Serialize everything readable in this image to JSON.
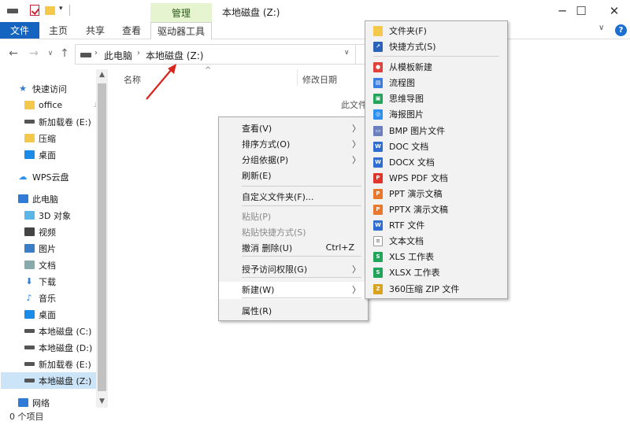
{
  "window": {
    "title": "本地磁盘 (Z:)",
    "manage_tab": "管理",
    "controls": {
      "minimize": "─",
      "maximize": "☐",
      "close": "✕"
    }
  },
  "ribbon": {
    "tabs": [
      "文件",
      "主页",
      "共享",
      "查看"
    ],
    "contextual_tab": "驱动器工具",
    "accent_color": "#1565c0"
  },
  "address": {
    "crumbs": [
      "此电脑",
      "本地磁盘 (Z:)"
    ]
  },
  "nav": {
    "items": [
      {
        "label": "快速访问",
        "icon": "star-icon"
      },
      {
        "label": "office",
        "icon": "folder-icon",
        "pinned": true
      },
      {
        "label": "新加载卷 (E:)",
        "icon": "drive-icon"
      },
      {
        "label": "压缩",
        "icon": "folder-icon"
      },
      {
        "label": "桌面",
        "icon": "desktop-icon"
      },
      {
        "label": "WPS云盘",
        "icon": "cloud-icon"
      },
      {
        "label": "此电脑",
        "icon": "computer-icon"
      },
      {
        "label": "3D 对象",
        "icon": "cube-icon"
      },
      {
        "label": "视频",
        "icon": "video-icon"
      },
      {
        "label": "图片",
        "icon": "picture-icon"
      },
      {
        "label": "文档",
        "icon": "document-icon"
      },
      {
        "label": "下载",
        "icon": "download-icon"
      },
      {
        "label": "音乐",
        "icon": "music-icon"
      },
      {
        "label": "桌面",
        "icon": "desktop-icon"
      },
      {
        "label": "本地磁盘 (C:)",
        "icon": "system-drive-icon"
      },
      {
        "label": "本地磁盘 (D:)",
        "icon": "drive-icon"
      },
      {
        "label": "新加载卷 (E:)",
        "icon": "drive-icon"
      },
      {
        "label": "本地磁盘 (Z:)",
        "icon": "drive-icon",
        "selected": true
      },
      {
        "label": "网络",
        "icon": "network-icon"
      }
    ]
  },
  "content": {
    "columns": {
      "name": "名称",
      "date": "修改日期"
    },
    "empty_text": "此文件"
  },
  "status": {
    "count": "0 个项目"
  },
  "context_menu": {
    "items": [
      {
        "label": "查看(V)",
        "submenu": true
      },
      {
        "label": "排序方式(O)",
        "submenu": true
      },
      {
        "label": "分组依据(P)",
        "submenu": true
      },
      {
        "label": "刷新(E)"
      },
      {
        "label": "自定义文件夹(F)..."
      },
      {
        "label": "粘贴(P)",
        "disabled": true
      },
      {
        "label": "粘贴快捷方式(S)",
        "disabled": true
      },
      {
        "label": "撤消 删除(U)",
        "shortcut": "Ctrl+Z"
      },
      {
        "label": "授予访问权限(G)",
        "submenu": true
      },
      {
        "label": "新建(W)",
        "submenu": true
      },
      {
        "label": "属性(R)"
      }
    ]
  },
  "new_submenu": {
    "items": [
      {
        "label": "文件夹(F)",
        "icon": "folder-icon",
        "color": "#f4c84a"
      },
      {
        "label": "快捷方式(S)",
        "icon": "shortcut-icon",
        "color": "#2a63b8"
      },
      {
        "label": "从模板新建",
        "icon": "template-icon",
        "color": "#e0423b"
      },
      {
        "label": "流程图",
        "icon": "flowchart-icon",
        "color": "#3b7ee0"
      },
      {
        "label": "思维导图",
        "icon": "mindmap-icon",
        "color": "#22a55a"
      },
      {
        "label": "海报图片",
        "icon": "poster-icon",
        "color": "#2d8ff0"
      },
      {
        "label": "BMP 图片文件",
        "icon": "bmp-file-icon",
        "color": "#6b7fbf"
      },
      {
        "label": "DOC 文档",
        "icon": "doc-file-icon",
        "color": "#2f6dd0"
      },
      {
        "label": "DOCX 文档",
        "icon": "docx-file-icon",
        "color": "#2f6dd0"
      },
      {
        "label": "WPS PDF 文档",
        "icon": "pdf-file-icon",
        "color": "#e0352b"
      },
      {
        "label": "PPT 演示文稿",
        "icon": "ppt-file-icon",
        "color": "#e8782d"
      },
      {
        "label": "PPTX 演示文稿",
        "icon": "pptx-file-icon",
        "color": "#e8782d"
      },
      {
        "label": "RTF 文件",
        "icon": "rtf-file-icon",
        "color": "#2f6dd0"
      },
      {
        "label": "文本文档",
        "icon": "text-file-icon",
        "color": "#9a9a9a"
      },
      {
        "label": "XLS 工作表",
        "icon": "xls-file-icon",
        "color": "#21a55a"
      },
      {
        "label": "XLSX 工作表",
        "icon": "xlsx-file-icon",
        "color": "#21a55a"
      },
      {
        "label": "360压缩 ZIP 文件",
        "icon": "zip-file-icon",
        "color": "#d9a21f"
      }
    ]
  }
}
